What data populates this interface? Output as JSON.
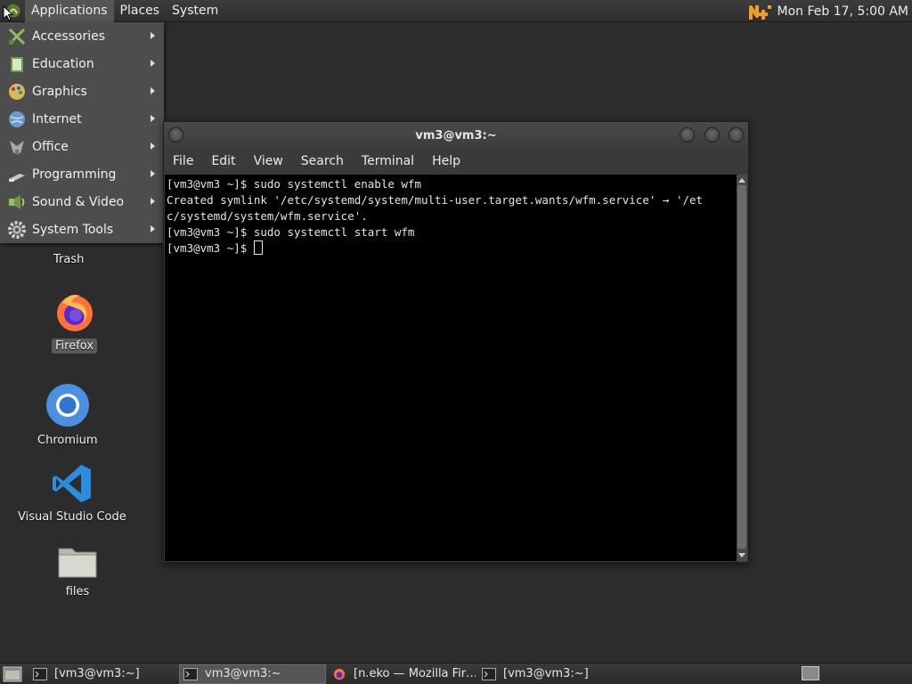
{
  "top_panel": {
    "menus": [
      "Applications",
      "Places",
      "System"
    ],
    "clock": "Mon Feb 17,  5:00 AM"
  },
  "apps_menu": {
    "items": [
      {
        "label": "Accessories",
        "icon": "accessories-icon"
      },
      {
        "label": "Education",
        "icon": "education-icon"
      },
      {
        "label": "Graphics",
        "icon": "graphics-icon"
      },
      {
        "label": "Internet",
        "icon": "internet-icon"
      },
      {
        "label": "Office",
        "icon": "office-icon"
      },
      {
        "label": "Programming",
        "icon": "programming-icon"
      },
      {
        "label": "Sound & Video",
        "icon": "sound-video-icon"
      },
      {
        "label": "System Tools",
        "icon": "system-tools-icon"
      }
    ]
  },
  "desktop": {
    "icons": [
      {
        "label": "Trash",
        "icon": "trash-icon"
      },
      {
        "label": "Firefox",
        "icon": "firefox-icon"
      },
      {
        "label": "Chromium",
        "icon": "chromium-icon"
      },
      {
        "label": "Visual Studio Code",
        "icon": "vscode-icon"
      },
      {
        "label": "files",
        "icon": "folder-icon"
      }
    ]
  },
  "terminal": {
    "title": "vm3@vm3:~",
    "menu": [
      "File",
      "Edit",
      "View",
      "Search",
      "Terminal",
      "Help"
    ],
    "lines": [
      "[vm3@vm3 ~]$ sudo systemctl enable wfm",
      "Created symlink '/etc/systemd/system/multi-user.target.wants/wfm.service' → '/et",
      "c/systemd/system/wfm.service'.",
      "[vm3@vm3 ~]$ sudo systemctl start wfm"
    ],
    "prompt": "[vm3@vm3 ~]$ "
  },
  "taskbar": {
    "tasks": [
      {
        "label": "[vm3@vm3:~]",
        "icon": "terminal-icon"
      },
      {
        "label": "vm3@vm3:~",
        "icon": "terminal-icon"
      },
      {
        "label": "[n.eko — Mozilla Fir…",
        "icon": "firefox-icon"
      },
      {
        "label": "[vm3@vm3:~]",
        "icon": "terminal-icon"
      }
    ]
  },
  "colors": {
    "panel": "#333333",
    "desktop": "#2c2c2c",
    "menu": "#4d4d4d",
    "terminal_bg": "#000000",
    "firefox_orange": "#ff7139",
    "chromium_blue": "#4a8fe0",
    "vscode_blue": "#2a8ddf"
  }
}
